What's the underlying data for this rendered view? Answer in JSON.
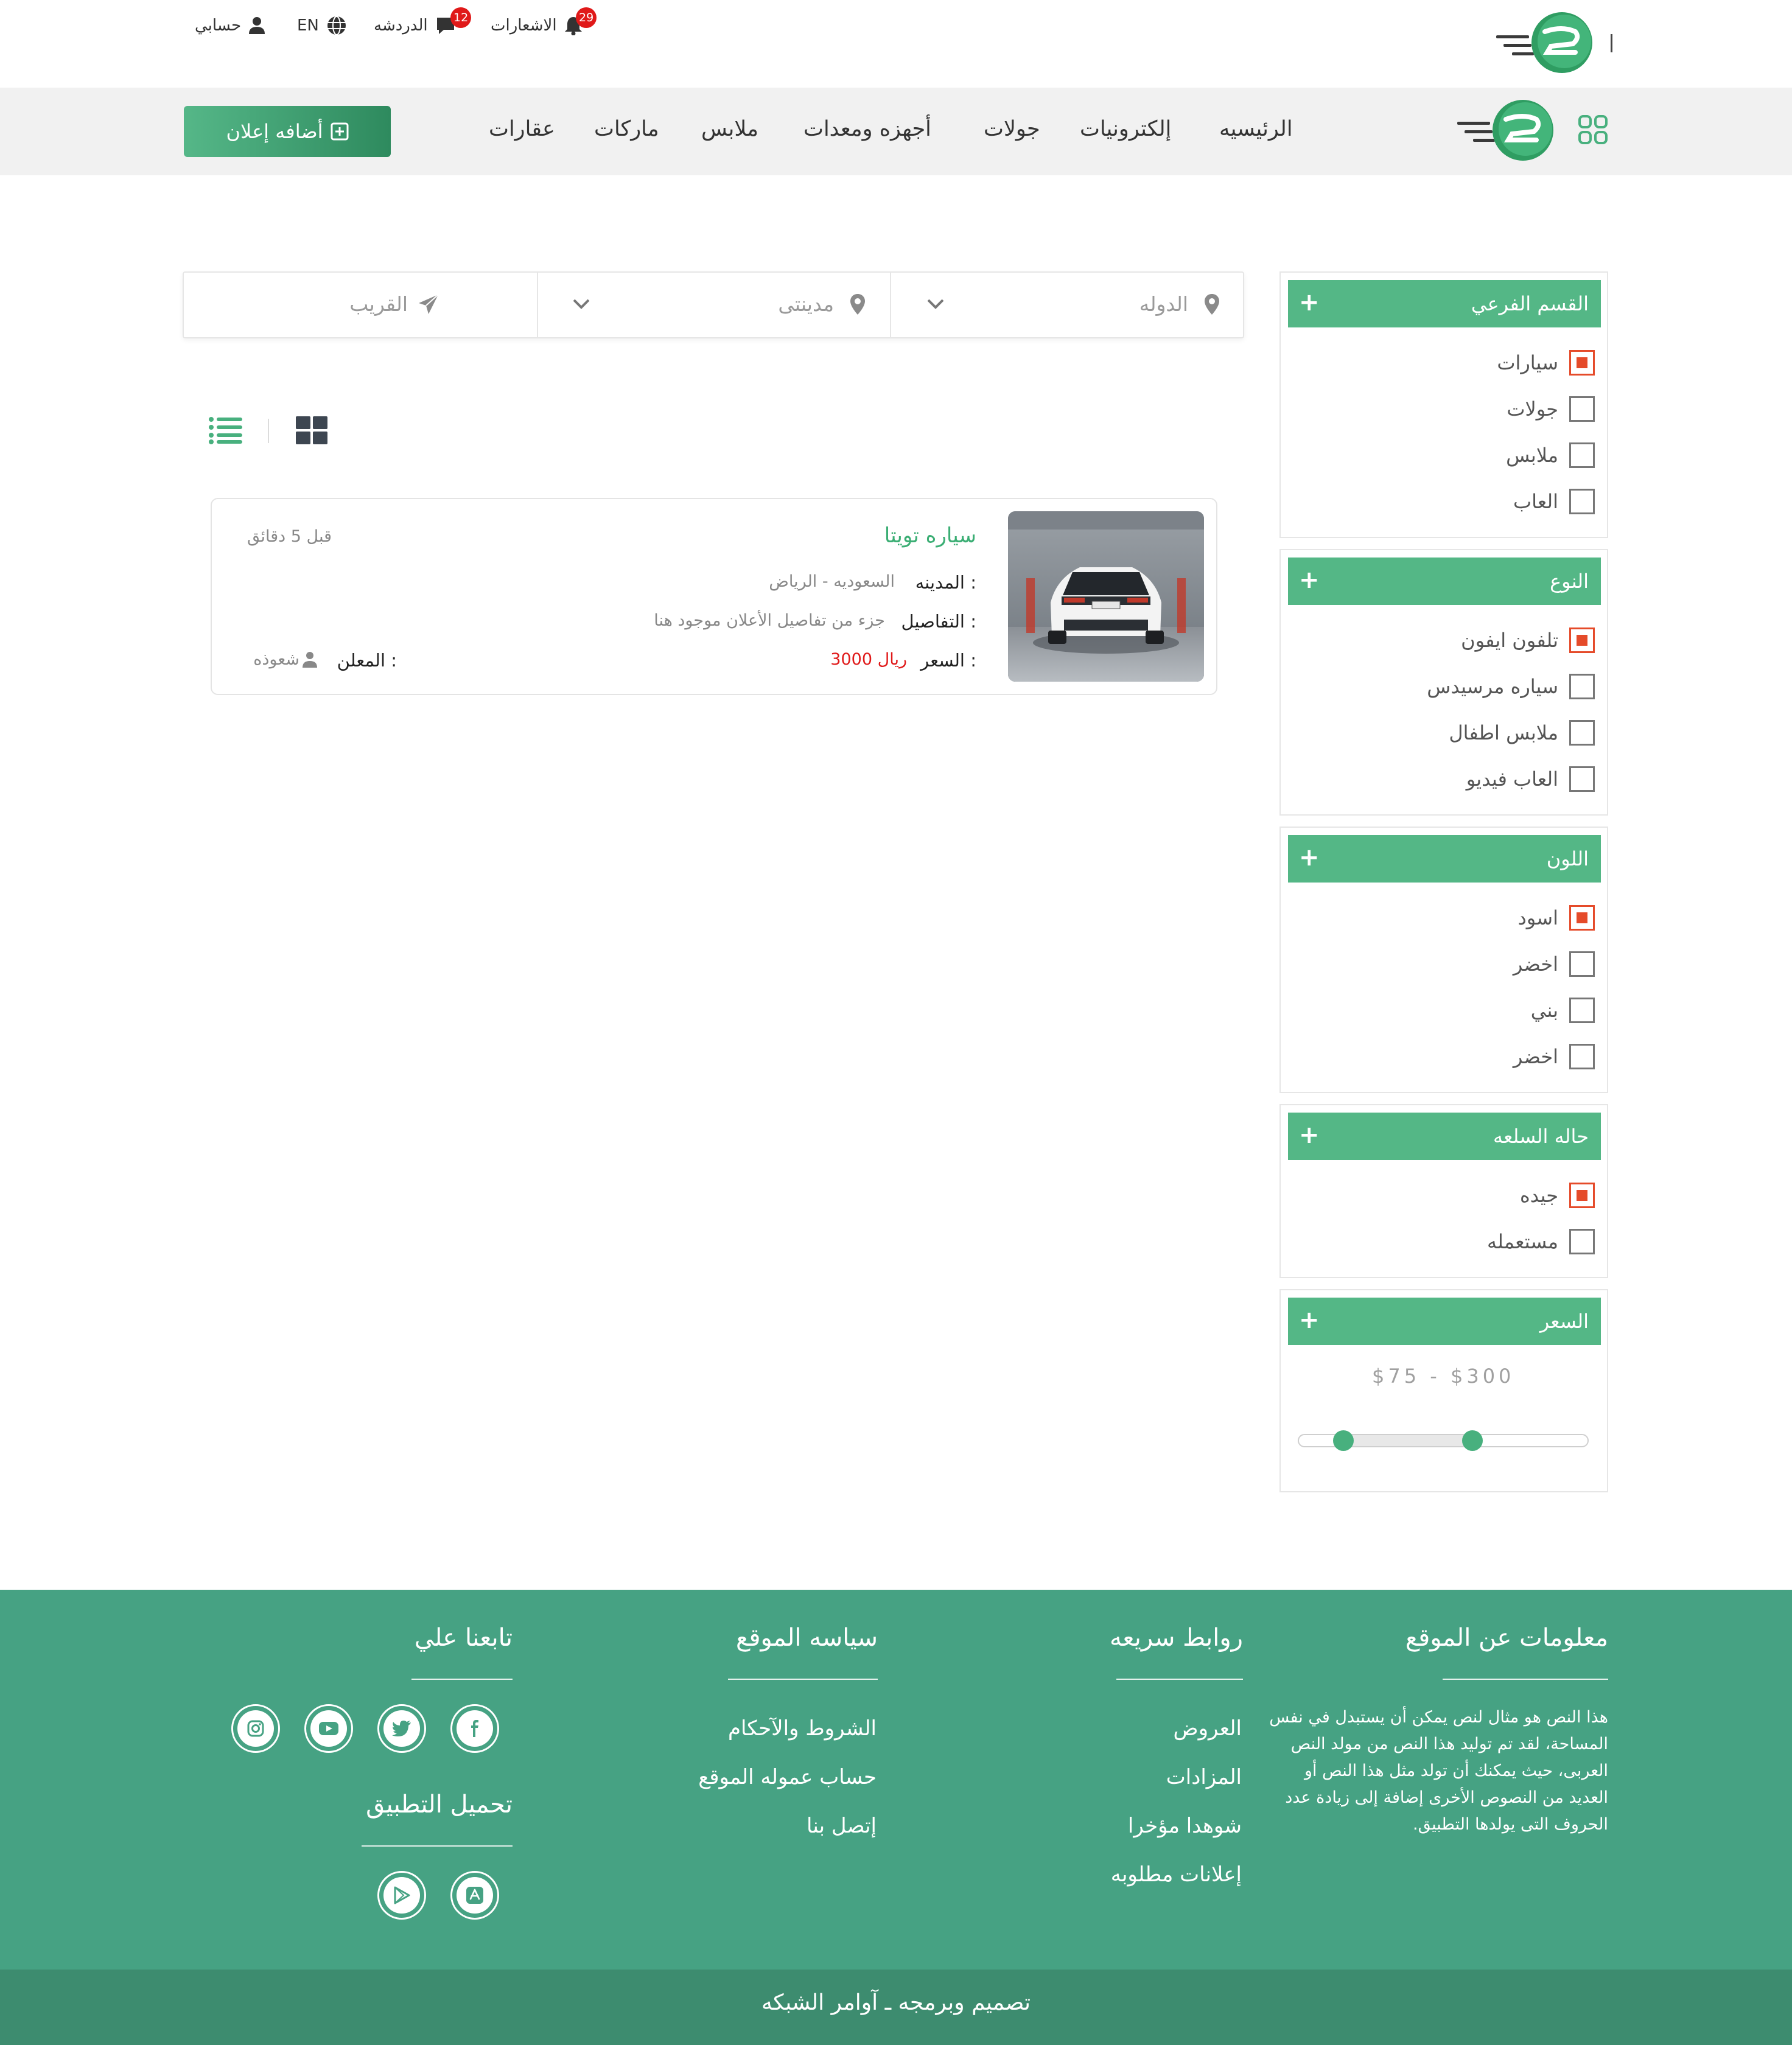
{
  "topbar": {
    "notifications_label": "الاشعارات",
    "notifications_count": "29",
    "chat_label": "الدردشه",
    "chat_count": "12",
    "language_label": "EN",
    "account_label": "حسابي"
  },
  "nav": {
    "links": [
      "الرئيسيه",
      "إلكترونيات",
      "جولات",
      "أجهزه ومعدات",
      "ملابس",
      "ماركات",
      "عقارات"
    ],
    "add_button": "أضافه إعلان"
  },
  "search": {
    "country_placeholder": "الدوله",
    "city_placeholder": "مدينتى",
    "nearby_label": "القريب"
  },
  "listing": {
    "title": "سياره تويتا",
    "time_ago": "قبل 5 دقائق",
    "city_label": "المدينه :",
    "city_value": "السعوديه - الرياض",
    "details_label": "التفاصيل :",
    "details_value": "جزء من تفاصيل الأعلان موجود هنا",
    "price_label": "السعر :",
    "price_value": "3000 ريال",
    "advertiser_label": "المعلن :",
    "advertiser_value": "شعوذه"
  },
  "filters": {
    "subcategory": {
      "title": "القسم الفرعي",
      "options": [
        {
          "label": "سيارات",
          "checked": true
        },
        {
          "label": "جولات",
          "checked": false
        },
        {
          "label": "ملابس",
          "checked": false
        },
        {
          "label": "العاب",
          "checked": false
        }
      ]
    },
    "type": {
      "title": "النوع",
      "options": [
        {
          "label": "تلفون ايفون",
          "checked": true
        },
        {
          "label": "سياره مرسيدس",
          "checked": false
        },
        {
          "label": "ملابس اطفال",
          "checked": false
        },
        {
          "label": "العاب فيديو",
          "checked": false
        }
      ]
    },
    "color": {
      "title": "اللون",
      "options": [
        {
          "label": "اسود",
          "checked": true
        },
        {
          "label": "اخضر",
          "checked": false
        },
        {
          "label": "بني",
          "checked": false
        },
        {
          "label": "اخضر",
          "checked": false
        }
      ]
    },
    "condition": {
      "title": "حاله السلعه",
      "options": [
        {
          "label": "جيده",
          "checked": true
        },
        {
          "label": "مستعمله",
          "checked": false
        }
      ]
    },
    "price": {
      "title": "السعر",
      "range_text": "$75 - $300",
      "min": 75,
      "max": 300
    }
  },
  "footer": {
    "about_title": "معلومات عن الموقع",
    "about_text": "هذا النص هو مثال لنص يمكن أن يستبدل في نفس المساحة، لقد تم توليد هذا النص من مولد النص العربى، حيث يمكنك أن تولد مثل هذا النص أو العديد من النصوص الأخرى إضافة إلى زيادة عدد الحروف التى يولدها التطبيق.",
    "quick_links_title": "روابط سريعه",
    "quick_links": [
      "العروض",
      "المزادات",
      "شوهدا مؤخرا",
      "إعلانات مطلوبه"
    ],
    "policy_title": "سياسه الموقع",
    "policy_links": [
      "الشروط والآحكام",
      "حساب عموله الموقع",
      "إتصل بنا"
    ],
    "follow_title": "تابعنا علي",
    "social_icons": [
      "facebook-icon",
      "twitter-icon",
      "youtube-icon",
      "instagram-icon"
    ],
    "app_title": "تحميل التطبيق",
    "app_icons": [
      "app-store-icon",
      "google-play-icon"
    ],
    "credit": "تصميم وبرمجه ـ آوامر الشبكه"
  },
  "colors": {
    "brand_green": "#54b786",
    "footer_green": "#46a283",
    "footer_bottom": "#3d8c6f",
    "check_orange": "#e54b2a",
    "price_red": "#e01919",
    "badge_red": "#e01919"
  }
}
